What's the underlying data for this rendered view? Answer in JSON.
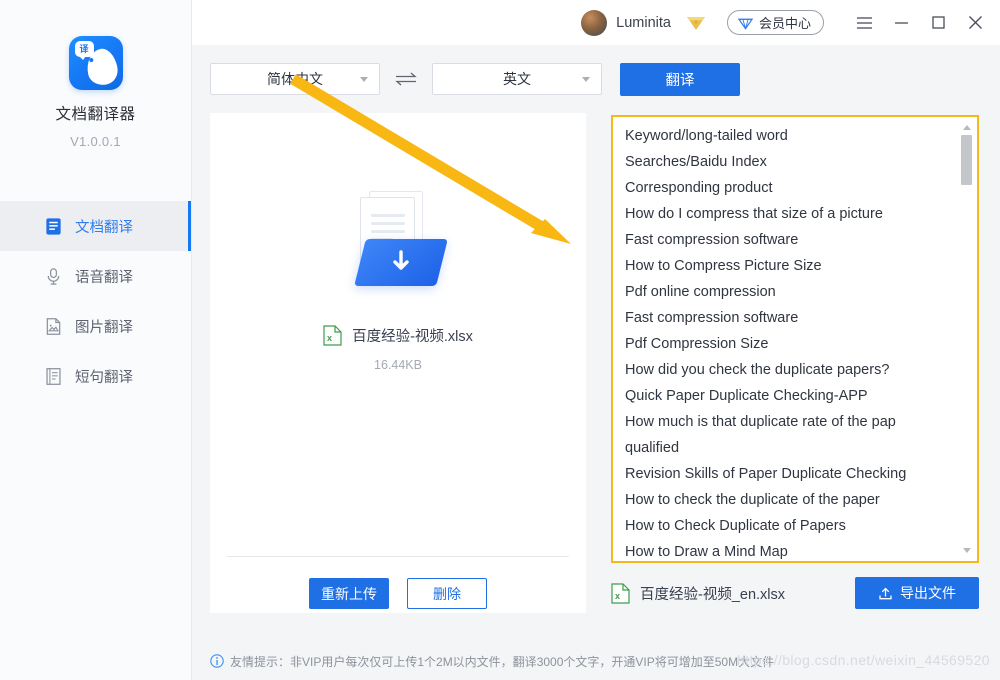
{
  "app": {
    "name": "文档翻译器",
    "version": "V1.0.0.1",
    "logo_char": "译",
    "logo_icon": "parrot-translate-logo"
  },
  "sidebar": {
    "items": [
      {
        "label": "文档翻译",
        "icon": "document-icon",
        "active": true
      },
      {
        "label": "语音翻译",
        "icon": "microphone-icon",
        "active": false
      },
      {
        "label": "图片翻译",
        "icon": "image-document-icon",
        "active": false
      },
      {
        "label": "短句翻译",
        "icon": "lined-document-icon",
        "active": false
      }
    ]
  },
  "header": {
    "user_name": "Luminita",
    "avatar_icon": "avatar",
    "vip_icon": "vip-diamond-icon",
    "member_label": "会员中心",
    "member_icon": "member-diamond-icon",
    "menu_icon": "hamburger-menu-icon",
    "minimize_icon": "minimize-icon",
    "maximize_icon": "maximize-icon",
    "close_icon": "close-icon"
  },
  "toolbar": {
    "source_language": "简体中文",
    "target_language": "英文",
    "swap_icon": "swap-arrows-icon",
    "translate_label": "翻译"
  },
  "file_panel": {
    "upload_icon": "document-folder-download-icon",
    "file_icon": "xlsx-icon",
    "file_name": "百度经验-视频.xlsx",
    "file_size": "16.44KB",
    "reupload_label": "重新上传",
    "delete_label": "删除"
  },
  "result_panel": {
    "lines": [
      "Keyword/long-tailed word",
      "Searches/Baidu Index",
      "Corresponding product",
      "How do I compress that size of a picture",
      "Fast compression software",
      "How to Compress Picture Size",
      "Pdf online compression",
      "Fast compression software",
      "Pdf Compression Size",
      "How did you check the duplicate papers?",
      "Quick Paper Duplicate Checking-APP",
      "How much is that duplicate rate of the pap",
      "qualified",
      "Revision Skills of Paper Duplicate Checking",
      "How to check the duplicate of the paper",
      "How to Check Duplicate of Papers",
      "How to Draw a Mind Map"
    ],
    "scroll_up_icon": "scroll-up-arrow-icon",
    "scroll_down_icon": "scroll-down-arrow-icon",
    "border_color": "#f4b81b"
  },
  "export_bar": {
    "file_icon": "xlsx-icon",
    "output_file_name": "百度经验-视频_en.xlsx",
    "export_label": "导出文件",
    "export_icon": "upload-export-icon"
  },
  "footer": {
    "info_icon": "info-circle-icon",
    "tip": "友情提示：非VIP用户每次仅可上传1个2M以内文件，翻译3000个文字，开通VIP将可增加至50M大文件"
  },
  "annotation": {
    "arrow_color": "#f8b712",
    "arrow_name": "yellow-annotation-arrow"
  },
  "watermark": {
    "text": "https://blog.csdn.net/weixin_44569520"
  },
  "colors": {
    "accent_blue": "#1f6fe5",
    "sidebar_bg": "#fafbfc",
    "page_bg": "#f4f5f7",
    "highlight_yellow": "#f4b81b"
  }
}
